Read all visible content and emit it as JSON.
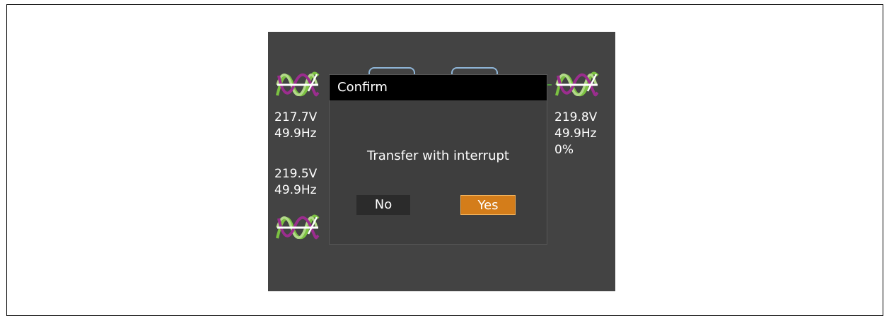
{
  "dialog": {
    "title": "Confirm",
    "message": "Transfer with interrupt",
    "no_label": "No",
    "yes_label": "Yes"
  },
  "left_panel": {
    "input1_voltage": "217.7V",
    "input1_frequency": "49.9Hz",
    "input2_voltage": "219.5V",
    "input2_frequency": "49.9Hz"
  },
  "right_panel": {
    "output_voltage": "219.8V",
    "output_frequency": "49.9Hz",
    "load_percent": "0%"
  },
  "icons": {
    "wave": "sine-wave-icon"
  },
  "colors": {
    "screen_bg": "#434343",
    "dialog_bg": "#3e3e3e",
    "title_bar": "#000000",
    "yes_button": "#d47d1a",
    "no_button": "#2b2b2b",
    "wave_green": "#7cc242",
    "wave_purple": "#9b2d8e"
  }
}
